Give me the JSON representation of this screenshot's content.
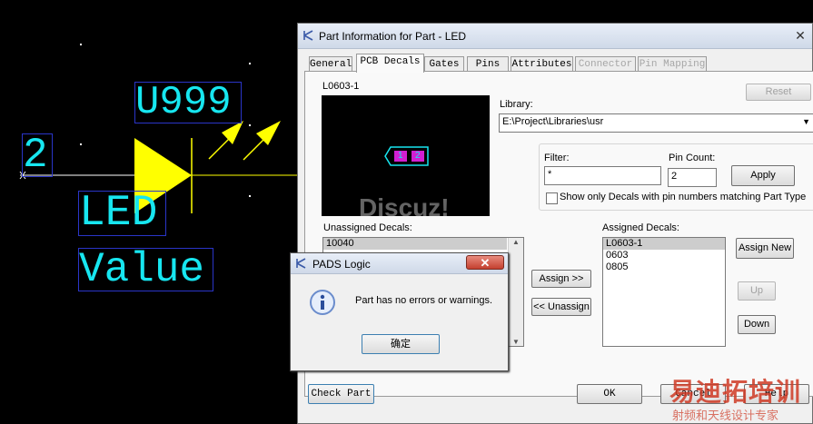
{
  "schematic": {
    "ref_designator": "U999",
    "pin_number": "2",
    "part_type": "LED",
    "value": "Value"
  },
  "part_dialog": {
    "title": "Part Information for Part - LED",
    "close_glyph": "✕",
    "tabs": [
      {
        "label": "General",
        "state": "normal"
      },
      {
        "label": "PCB Decals",
        "state": "active"
      },
      {
        "label": "Gates",
        "state": "normal"
      },
      {
        "label": "Pins",
        "state": "normal"
      },
      {
        "label": "Attributes",
        "state": "normal"
      },
      {
        "label": "Connector",
        "state": "disabled"
      },
      {
        "label": "Pin Mapping",
        "state": "disabled"
      }
    ],
    "current_decal": "L0603-1",
    "preview_pins": [
      "1",
      "2"
    ],
    "reset_button": "Reset",
    "library_label": "Library:",
    "library_value": "E:\\Project\\Libraries\\usr",
    "filter_label": "Filter:",
    "filter_value": "*",
    "pin_count_label": "Pin Count:",
    "pin_count_value": "2",
    "apply_button": "Apply",
    "show_only_label": "Show only Decals with pin numbers matching Part Type",
    "show_only_checked": false,
    "unassigned_label": "Unassigned Decals:",
    "unassigned_items": [
      "10040"
    ],
    "assign_button": "Assign >>",
    "unassign_button": "<< Unassign",
    "assigned_label": "Assigned Decals:",
    "assigned_items": [
      "L0603-1",
      "0603",
      "0805"
    ],
    "assign_new_button": "Assign New",
    "up_button": "Up",
    "down_button": "Down",
    "check_part_button": "Check Part",
    "ok_button": "OK",
    "cancel_button": "Cancel",
    "help_button": "Help"
  },
  "popup": {
    "title": "PADS Logic",
    "message": "Part has no errors or warnings.",
    "ok_button": "确定",
    "close_glyph": "✕"
  },
  "watermarks": {
    "discuz": "Discuz!",
    "brand_cn": "易迪拓培训",
    "brand_sub": "射频和天线设计专家"
  },
  "colors": {
    "schematic_text": "#17e6f0",
    "schematic_box": "#2a35c8",
    "led_body": "#ffff00",
    "decal_outline": "#17e6f0",
    "decal_pad": "#d21fd2",
    "watermark": "#cf3a25"
  }
}
